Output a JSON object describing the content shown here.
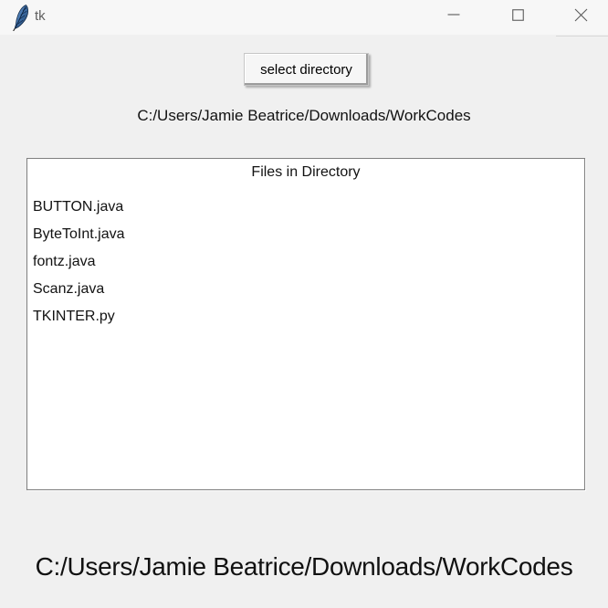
{
  "window": {
    "title": "tk"
  },
  "main": {
    "select_button_label": "select directory",
    "directory_path": "C:/Users/Jamie Beatrice/Downloads/WorkCodes",
    "footer_path": "C:/Users/Jamie Beatrice/Downloads/WorkCodes"
  },
  "listbox": {
    "header": "Files in Directory",
    "items": [
      "BUTTON.java",
      "ByteToInt.java",
      "fontz.java",
      "Scanz.java",
      "TKINTER.py"
    ]
  },
  "icons": {
    "app_icon": "tk-feather-icon",
    "minimize": "minimize-icon",
    "maximize": "maximize-icon",
    "close": "close-icon"
  },
  "colors": {
    "titlebar_bg": "#f7f7f7",
    "window_bg": "#f0f0f0",
    "listbox_bg": "#ffffff",
    "listbox_border": "#7f7f7f",
    "button_bg": "#f6f6f6",
    "text": "#121212",
    "title_text": "#5f5f5f",
    "control_glyph": "#5a5a5a",
    "feather_blue": "#3f6fa8"
  }
}
